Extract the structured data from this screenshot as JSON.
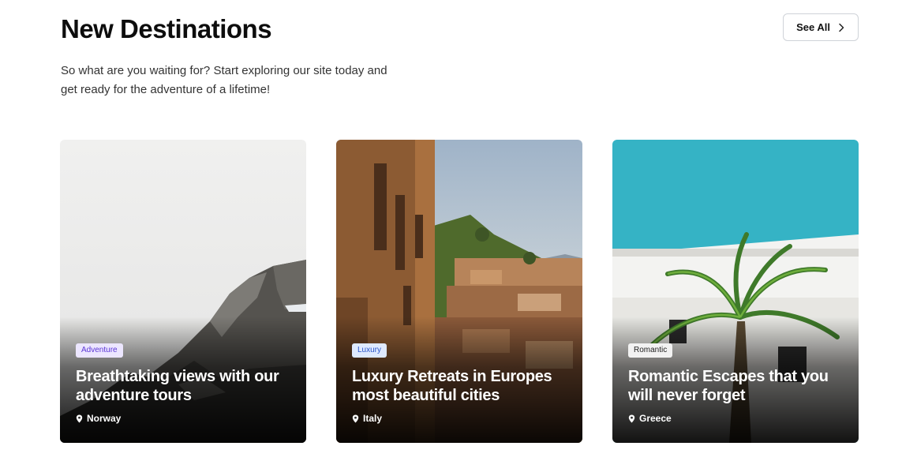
{
  "header": {
    "title": "New Destinations",
    "subtitle": "So what are you waiting for? Start exploring our site today and get ready for the adventure of a lifetime!",
    "see_all_label": "See All"
  },
  "cards": [
    {
      "badge": "Adventure",
      "badge_bg": "#ece6ff",
      "badge_color": "#5b35d5",
      "title": "Breathtaking views with our adventure tours",
      "location": "Norway",
      "image": "mountain-peak-photo"
    },
    {
      "badge": "Luxury",
      "badge_bg": "#dfeaff",
      "badge_color": "#2a55c9",
      "title": "Luxury Retreats in Europes most beautiful cities",
      "location": "Italy",
      "image": "italian-village-photo"
    },
    {
      "badge": "Romantic",
      "badge_bg": "#f2f2f2",
      "badge_color": "#222222",
      "title": "Romantic Escapes that you will never forget",
      "location": "Greece",
      "image": "palm-tree-white-house-photo"
    }
  ],
  "icons": {
    "see_all": "chevron-right-icon",
    "location": "map-pin-icon"
  }
}
